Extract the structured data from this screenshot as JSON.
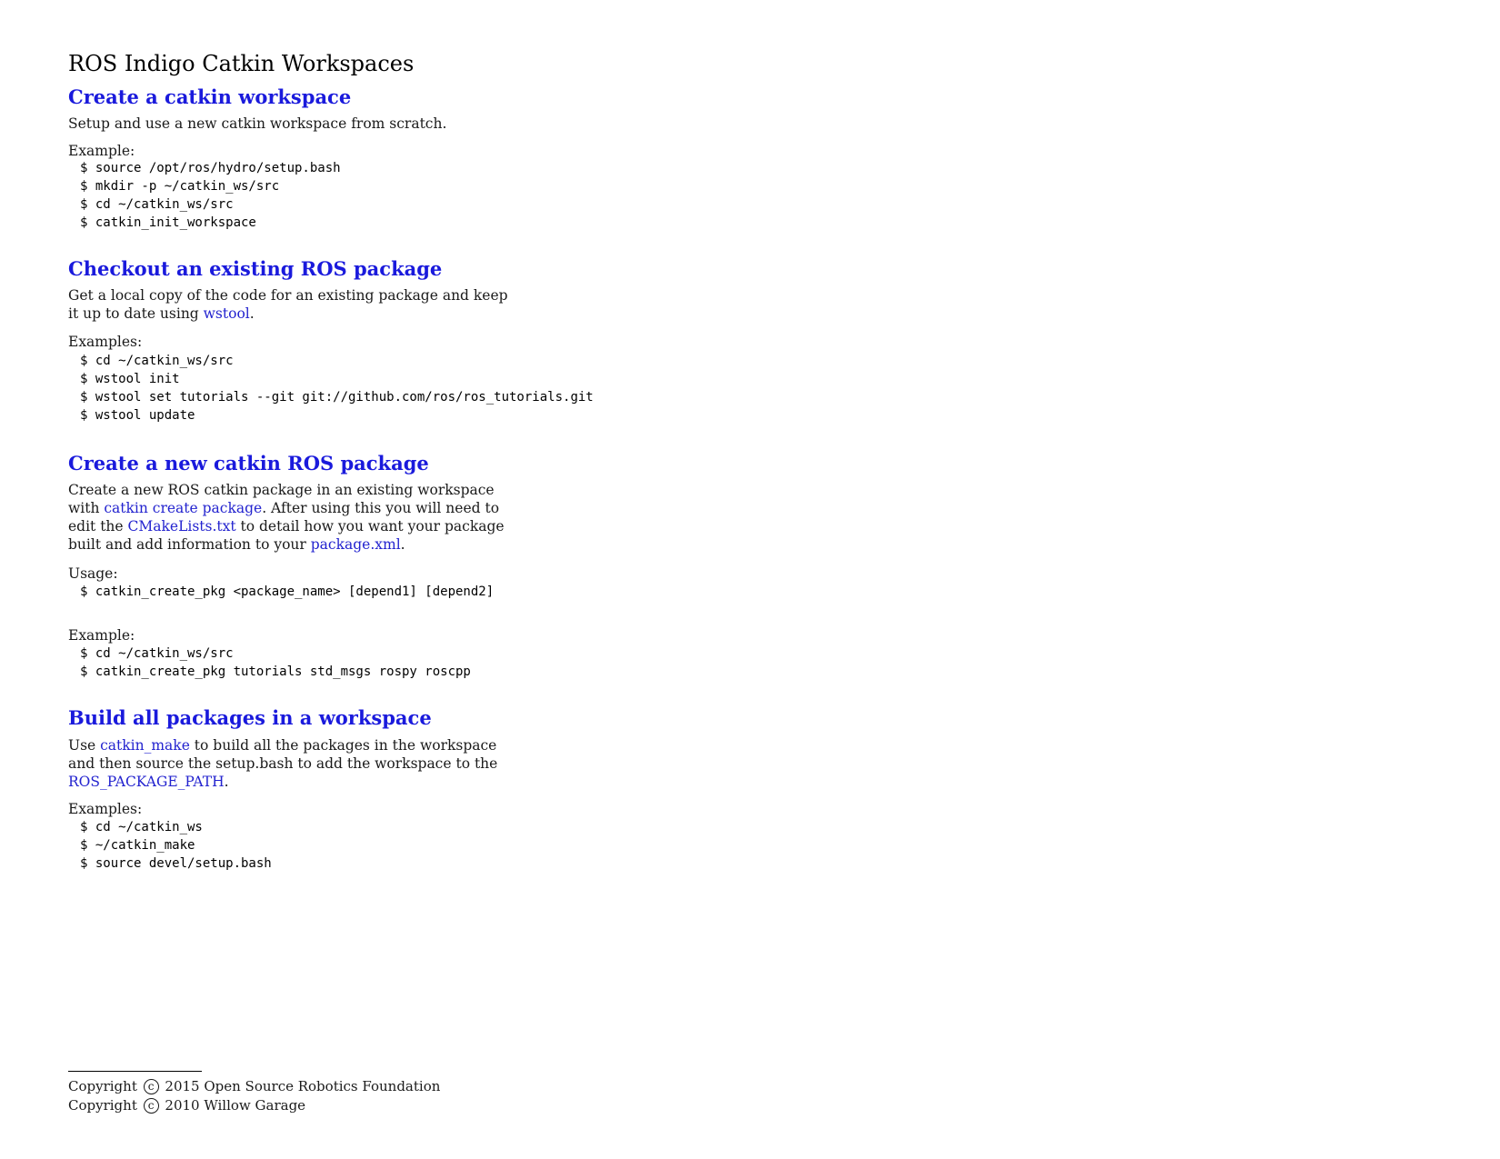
{
  "title": "ROS Indigo Catkin Workspaces",
  "sections": [
    {
      "heading": "Create a catkin workspace",
      "desc": "Setup and use a new catkin workspace from scratch.",
      "label": "Example:",
      "code": [
        "$ source /opt/ros/hydro/setup.bash",
        "$ mkdir -p ~/catkin_ws/src",
        "$ cd ~/catkin_ws/src",
        "$ catkin_init_workspace"
      ]
    },
    {
      "heading": "Checkout an existing ROS package",
      "desc_line1": "Get a local copy of the code for an existing package and keep",
      "desc_line2_pre": "it up to date using ",
      "desc_link": "wstool",
      "desc_line2_post": ".",
      "label": "Examples:",
      "code": [
        "$ cd ~/catkin_ws/src",
        "$ wstool init",
        "$ wstool set tutorials --git git://github.com/ros/ros_tutorials.git",
        "$ wstool update"
      ]
    },
    {
      "heading": "Create a new catkin ROS package",
      "line1": "Create a new ROS catkin package in an existing workspace",
      "line2_pre": "with ",
      "line2_link": "catkin create package",
      "line2_post": ". After using this you will need to",
      "line3_pre": "edit the ",
      "line3_link": "CMakeLists.txt",
      "line3_post": " to detail how you want your package",
      "line4_pre": "built and add information to your ",
      "line4_link": "package.xml",
      "line4_post": ".",
      "usage_label": "Usage:",
      "usage_code": "$ catkin_create_pkg <package_name> [depend1] [depend2]",
      "label": "Example:",
      "code": [
        "$ cd ~/catkin_ws/src",
        "$ catkin_create_pkg tutorials std_msgs rospy roscpp"
      ]
    },
    {
      "heading": "Build all packages in a workspace",
      "line1_pre": "Use ",
      "line1_link": "catkin_make",
      "line1_post": " to build all the packages in the workspace",
      "line2": "and then source the setup.bash to add the workspace to the",
      "line3_link": "ROS_PACKAGE_PATH",
      "line3_post": ".",
      "label": "Examples:",
      "code": [
        "$ cd ~/catkin_ws",
        "$ ~/catkin_make",
        "$ source devel/setup.bash"
      ]
    }
  ],
  "footer": {
    "copyright_word": "Copyright",
    "copyright_symbol": "c",
    "line1_rest": "2015 Open Source Robotics Foundation",
    "line2_rest": "2010 Willow Garage"
  }
}
